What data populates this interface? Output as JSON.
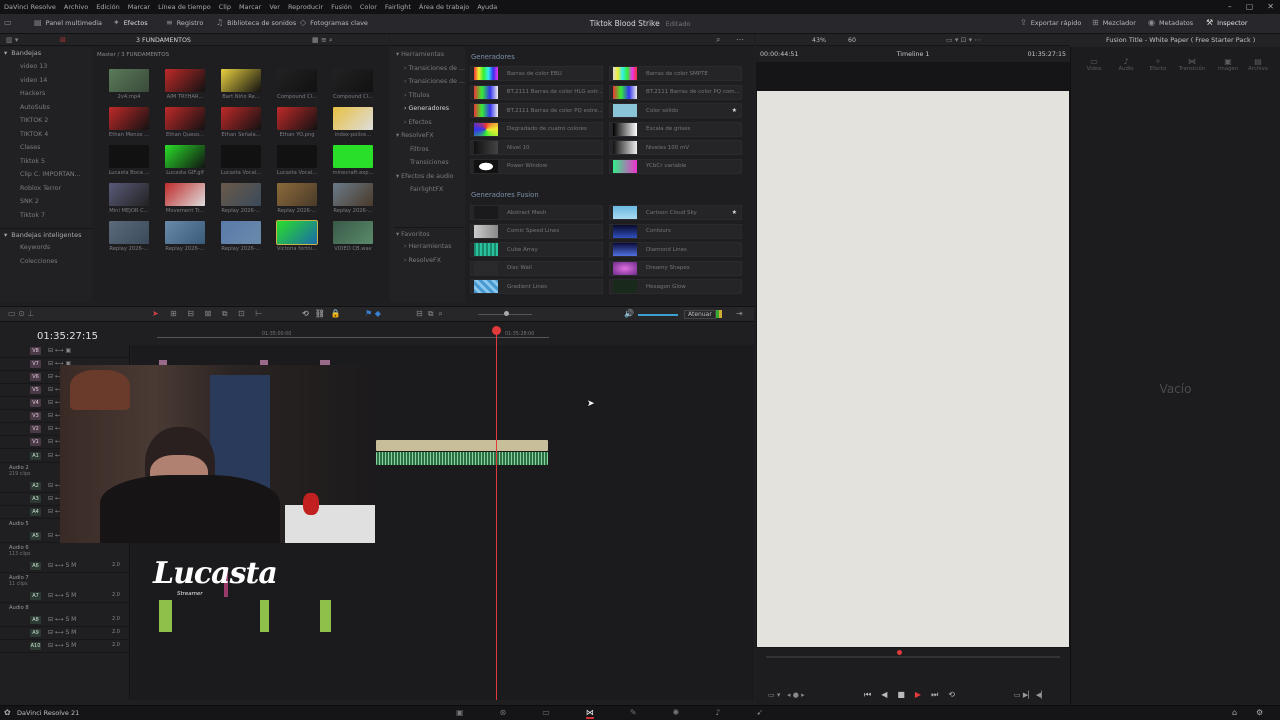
{
  "app": {
    "name": "DaVinci Resolve",
    "version_label": "DaVinci Resolve 21"
  },
  "menu": [
    "DaVinci Resolve",
    "Archivo",
    "Edición",
    "Marcar",
    "Línea de tiempo",
    "Clip",
    "Marcar",
    "Ver",
    "Reproducir",
    "Fusión",
    "Color",
    "Fairlight",
    "Área de trabajo",
    "Ayuda"
  ],
  "toolbar": {
    "media_pool": "Panel multimedia",
    "effects": "Efectos",
    "index": "Registro",
    "sound_library": "Biblioteca de sonidos",
    "keyframes": "Fotogramas clave",
    "project_title": "Tiktok Blood Strike",
    "project_status": "Editado",
    "quick_export": "Exportar rápido",
    "mixer": "Mezclador",
    "metadata": "Metadatos",
    "inspector": "Inspector"
  },
  "bins": {
    "header": "Bandejas",
    "items": [
      "video 13",
      "video 14",
      "Hackers",
      "AutoSubs",
      "TIKTOK 2",
      "TIKTOK 4",
      "Clases",
      "Tiktok 5",
      "Clip C. IMPORTAN...",
      "Roblox Terror",
      "SNK 2",
      "Tiktok 7"
    ],
    "smart_header": "Bandejas inteligentes",
    "smart_items": [
      "Keywords",
      "Colecciones"
    ]
  },
  "pool": {
    "path": "Master / 3 FUNDAMENTOS",
    "bin_title": "3 FUNDAMENTOS",
    "clips": [
      "2v4.mp4",
      "AIM TRYHAR...",
      "Bart Niño Re...",
      "Compound Cl...",
      "Compound Cl...",
      "Ethan Menos ...",
      "Ethan Queso...",
      "Ethan Señala...",
      "Ethan YO.png",
      "index-police...",
      "Lucasta Boca ...",
      "Lucasta GIF.gif",
      "Lucasta Vocal...",
      "Lucasta Vocal...",
      "minecraft.exp...",
      "Mini MEJOR C...",
      "Movement Tr...",
      "Replay 2026-...",
      "Replay 2026-...",
      "Replay 2026-...",
      "Replay 2026-...",
      "Replay 2026-...",
      "Replay 2026-...",
      "Victoria fortni...",
      "VIDEO CB.wav"
    ]
  },
  "effects_tree": {
    "items": [
      "Herramientas",
      "Transiciones de ...",
      "Transiciones de ...",
      "Títulos",
      "Generadores",
      "Efectos",
      "ResolveFX",
      "Filtros",
      "Transiciones",
      "Efectos de audio",
      "FairlightFX"
    ],
    "active": "Generadores",
    "favorites": "Favoritos",
    "fav_items": [
      "Herramientas",
      "ResolveFX"
    ]
  },
  "generators": {
    "section1": "Generadores",
    "items1": [
      "Barras de color EBU",
      "Barras de color SMPTE",
      "BT.2111 Barras de color HLG estr...",
      "BT.2111 Barras de color PQ com...",
      "BT.2111 Barras de color PQ estre...",
      "Color sólido",
      "Degradado de cuatro colores",
      "Escala de grises",
      "Nivel 10",
      "Niveles 100 mV",
      "Power Window",
      "YCbCr variable"
    ],
    "section2": "Generadores Fusion",
    "items2": [
      "Abstract Mesh",
      "Cartoon Cloud Sky",
      "Comic Speed Lines",
      "Contours",
      "Cube Array",
      "Diamond Lines",
      "Disc Wall",
      "Dreamy Shapes",
      "Gradient Lines",
      "Hexagon Glow"
    ]
  },
  "viewer": {
    "zoom": "43%",
    "fps": "60",
    "source_tc": "00:00:44:51",
    "timeline_name": "Timeline 1",
    "record_tc": "01:35:27:15"
  },
  "inspector": {
    "clip_title": "Fusion Title - White Paper ( Free Starter Pack )",
    "tabs": [
      "Video",
      "Audio",
      "Efecto",
      "Transición",
      "Imagen",
      "Archivo"
    ],
    "empty_label": "Vacío"
  },
  "timeline": {
    "timecode": "01:35:27:15",
    "ruler_marks": [
      "01:35:00:00",
      "01:35:28:00"
    ],
    "mute_label": "Atenuar",
    "video_tracks": [
      "V8",
      "V7",
      "V6",
      "V5",
      "V4",
      "V3",
      "V2",
      "V1"
    ],
    "audio_tracks": [
      {
        "id": "A1",
        "name": ""
      },
      {
        "id": "A2",
        "name": "Audio 2",
        "clips": "219 clips"
      },
      {
        "id": "A3",
        "name": ""
      },
      {
        "id": "A4",
        "name": ""
      },
      {
        "id": "A5",
        "name": "Audio 5"
      },
      {
        "id": "A6",
        "name": "Audio 6",
        "clips": "113 clips"
      },
      {
        "id": "A7",
        "name": "Audio 7",
        "clips": "11 clips"
      },
      {
        "id": "A8",
        "name": "Audio 8"
      },
      {
        "id": "A9",
        "name": ""
      },
      {
        "id": "A10",
        "name": ""
      }
    ],
    "level": "2.0"
  },
  "overlay": {
    "logo": "Lucasta",
    "logo_sub": "Streamer"
  },
  "colors": {
    "playhead": "#e03a3a",
    "audio_clip": "#3f8f58",
    "video_clip": "#c8bf9a",
    "accent": "#c9b24b"
  }
}
